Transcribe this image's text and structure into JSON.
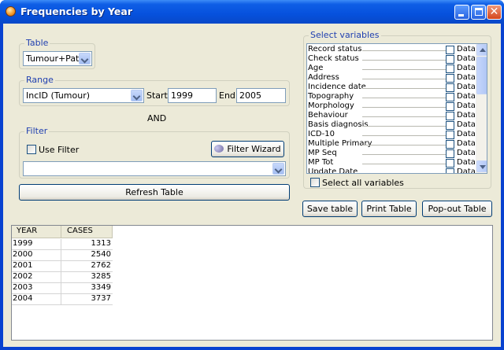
{
  "window": {
    "title": "Frequencies by Year"
  },
  "table_group": {
    "label": "Table",
    "selected": "Tumour+Pati..."
  },
  "range_group": {
    "label": "Range",
    "selected": "IncID (Tumour)",
    "start_label": "Start:",
    "start_value": "1999",
    "end_label": "End:",
    "end_value": "2005"
  },
  "and_label": "AND",
  "filter_group": {
    "label": "Filter",
    "use_filter_label": "Use Filter",
    "wizard_label": "Filter Wizard",
    "filter_value": ""
  },
  "refresh_label": "Refresh Table",
  "variables_group": {
    "label": "Select variables",
    "items": [
      {
        "name": "Record status",
        "type": "Data"
      },
      {
        "name": "Check status",
        "type": "Data"
      },
      {
        "name": "Age",
        "type": "Data"
      },
      {
        "name": "Address",
        "type": "Data"
      },
      {
        "name": "Incidence date",
        "type": "Data"
      },
      {
        "name": "Topography",
        "type": "Data"
      },
      {
        "name": "Morphology",
        "type": "Data"
      },
      {
        "name": "Behaviour",
        "type": "Data"
      },
      {
        "name": "Basis diagnosis",
        "type": "Data"
      },
      {
        "name": "ICD-10",
        "type": "Data"
      },
      {
        "name": "Multiple Primary",
        "type": "Data"
      },
      {
        "name": "MP Seq",
        "type": "Data"
      },
      {
        "name": "MP Tot",
        "type": "Data"
      },
      {
        "name": "Update Date",
        "type": "Data"
      }
    ],
    "select_all_label": "Select all variables"
  },
  "actions": {
    "save": "Save table",
    "print": "Print Table",
    "popout": "Pop-out Table"
  },
  "results": {
    "columns": [
      "YEAR",
      "CASES"
    ],
    "rows": [
      {
        "year": "1999",
        "cases": "1313"
      },
      {
        "year": "2000",
        "cases": "2540"
      },
      {
        "year": "2001",
        "cases": "2762"
      },
      {
        "year": "2002",
        "cases": "3285"
      },
      {
        "year": "2003",
        "cases": "3349"
      },
      {
        "year": "2004",
        "cases": "3737"
      }
    ]
  }
}
